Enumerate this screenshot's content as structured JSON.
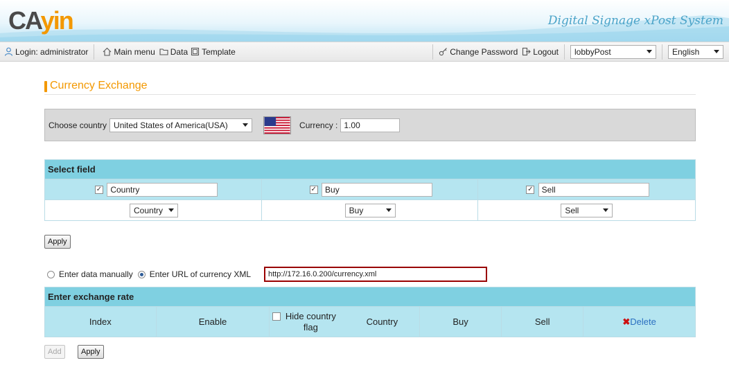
{
  "header": {
    "logo_ca": "CA",
    "logo_yin": "yin",
    "tagline": "Digital Signage xPost System"
  },
  "menubar": {
    "login_label": "Login: administrator",
    "main_menu": "Main menu",
    "data": "Data",
    "template": "Template",
    "change_password": "Change Password",
    "logout": "Logout",
    "site_select": "lobbyPost",
    "language_select": "English"
  },
  "page": {
    "title": "Currency Exchange"
  },
  "country_panel": {
    "choose_label": "Choose country",
    "country_value": "United States of America(USA)",
    "currency_label": "Currency :",
    "currency_value": "1.00"
  },
  "select_field": {
    "heading": "Select field",
    "fields": [
      {
        "checked": "✓",
        "value": "Country",
        "select": "Country"
      },
      {
        "checked": "✓",
        "value": "Buy",
        "select": "Buy"
      },
      {
        "checked": "✓",
        "value": "Sell",
        "select": "Sell"
      }
    ],
    "apply_label": "Apply"
  },
  "source": {
    "manual_label": "Enter data manually",
    "url_label": "Enter URL of currency XML",
    "url_value": "http://172.16.0.200/currency.xml"
  },
  "exchange_rate": {
    "heading": "Enter exchange rate",
    "columns": {
      "index": "Index",
      "enable": "Enable",
      "hide_flag": "Hide country flag",
      "country": "Country",
      "buy": "Buy",
      "sell": "Sell",
      "delete": "Delete"
    },
    "add_label": "Add",
    "apply_label": "Apply"
  },
  "colors": {
    "accent": "#f39800",
    "table_header": "#7fd0e1",
    "table_row": "#b5e5f0",
    "url_border": "#990000"
  }
}
